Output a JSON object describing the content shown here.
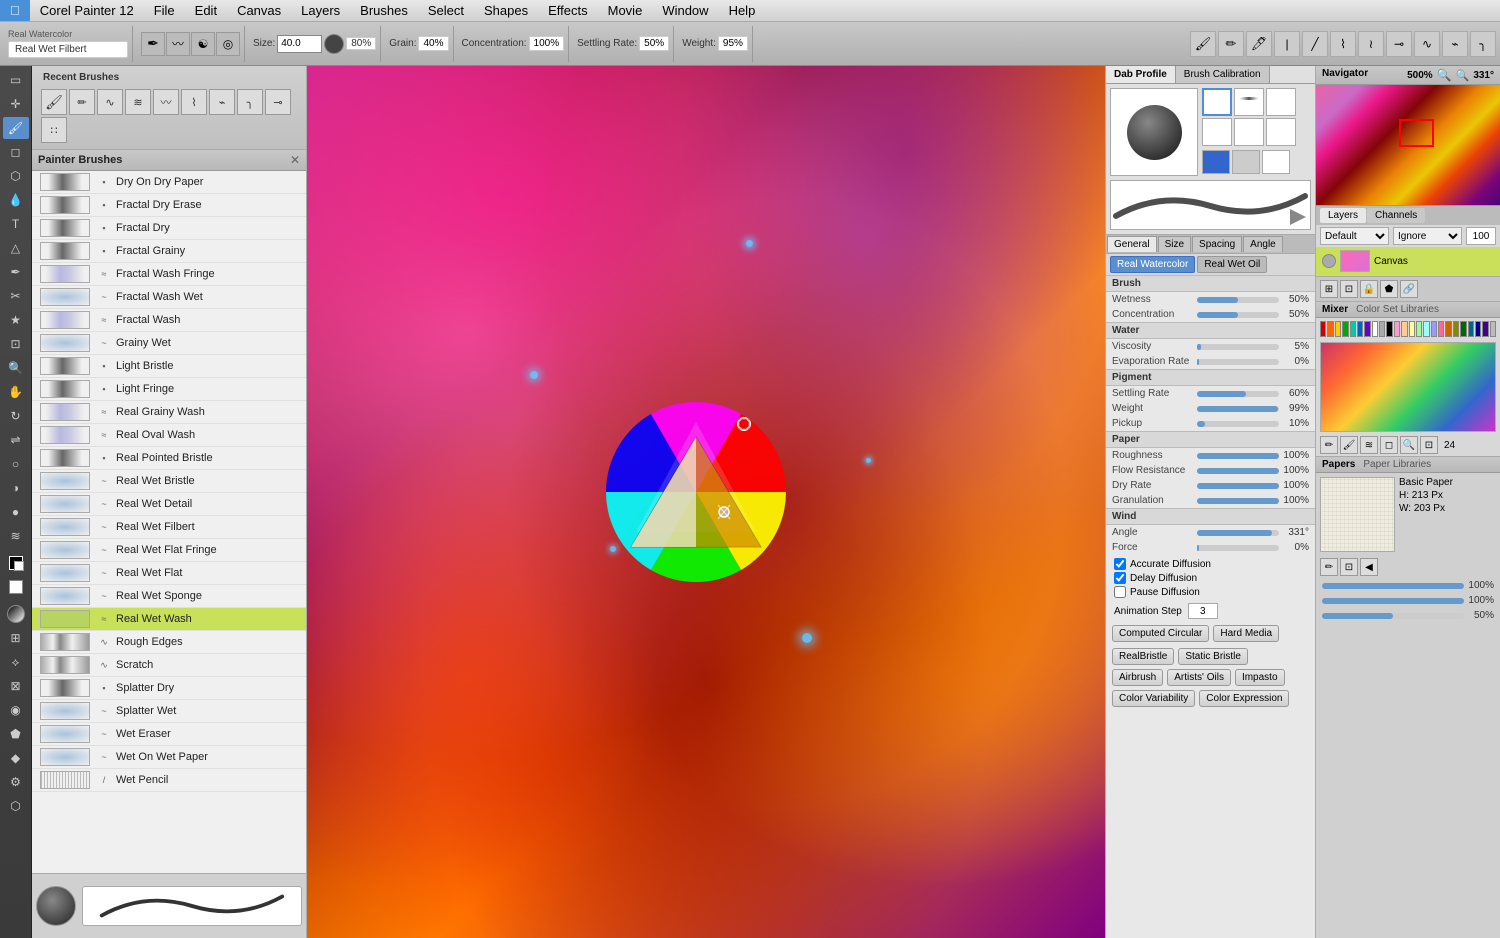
{
  "app": {
    "title": "Corel Painter 12",
    "menus": [
      "File",
      "Edit",
      "Canvas",
      "Layers",
      "Brushes",
      "Select",
      "Shapes",
      "Effects",
      "Movie",
      "Window",
      "Help"
    ]
  },
  "toolbar": {
    "brush_label": "Real Watercolor",
    "brush_name": "Real Wet Filbert",
    "size_value": "40.0",
    "size_unit": "",
    "opacity_label": "80%",
    "grain_label": "Grain:",
    "grain_value": "40%",
    "concentration_label": "Concentration:",
    "concentration_value": "100%",
    "settling_label": "Settling Rate:",
    "settling_value": "50%",
    "weight_label": "Weight:",
    "weight_value": "95%"
  },
  "brush_panel": {
    "recent_label": "Recent Brushes",
    "panel_title": "Painter Brushes",
    "brushes": [
      {
        "name": "Dry On Dry Paper",
        "type": "dry"
      },
      {
        "name": "Fractal Dry Erase",
        "type": "dry"
      },
      {
        "name": "Fractal Dry",
        "type": "dry"
      },
      {
        "name": "Fractal Grainy",
        "type": "dry"
      },
      {
        "name": "Fractal Wash Fringe",
        "type": "wash"
      },
      {
        "name": "Fractal Wash Wet",
        "type": "wet"
      },
      {
        "name": "Fractal Wash",
        "type": "wash"
      },
      {
        "name": "Grainy Wet",
        "type": "wet"
      },
      {
        "name": "Light Bristle",
        "type": "dry"
      },
      {
        "name": "Light Fringe",
        "type": "dry"
      },
      {
        "name": "Real Grainy Wash",
        "type": "wash"
      },
      {
        "name": "Real Oval Wash",
        "type": "wash"
      },
      {
        "name": "Real Pointed Bristle",
        "type": "dry"
      },
      {
        "name": "Real Wet Bristle",
        "type": "wet"
      },
      {
        "name": "Real Wet Detail",
        "type": "wet"
      },
      {
        "name": "Real Wet Filbert",
        "type": "wet"
      },
      {
        "name": "Real Wet Flat Fringe",
        "type": "wet"
      },
      {
        "name": "Real Wet Flat",
        "type": "wet"
      },
      {
        "name": "Real Wet Sponge",
        "type": "wet"
      },
      {
        "name": "Real Wet Wash",
        "type": "wash",
        "selected": true
      },
      {
        "name": "Rough Edges",
        "type": "rough"
      },
      {
        "name": "Scratch",
        "type": "rough"
      },
      {
        "name": "Splatter Dry",
        "type": "dry"
      },
      {
        "name": "Splatter Wet",
        "type": "wet"
      },
      {
        "name": "Wet Eraser",
        "type": "wet"
      },
      {
        "name": "Wet On Wet Paper",
        "type": "wet"
      },
      {
        "name": "Wet Pencil",
        "type": "pencil"
      }
    ]
  },
  "dab_profile": {
    "tab1": "Dab Profile",
    "tab2": "Brush Calibration"
  },
  "properties": {
    "tabs": {
      "general": "General",
      "size": "Size",
      "spacing": "Spacing",
      "angle": "Angle"
    },
    "watercolor_tabs": {
      "tab1": "Real Watercolor",
      "tab2": "Real Wet Oil"
    },
    "brush_section": "Brush",
    "wetness_label": "Wetness",
    "wetness_value": "50%",
    "concentration_label": "Concentration",
    "concentration_value": "50%",
    "water_section": "Water",
    "viscosity_label": "Viscosity",
    "viscosity_value": "5%",
    "evaporation_label": "Evaporation Rate",
    "evaporation_value": "0%",
    "pigment_section": "Pigment",
    "settling_label": "Settling Rate",
    "settling_value": "60%",
    "weight_label": "Weight",
    "weight_value": "99%",
    "pickup_label": "Pickup",
    "pickup_value": "10%",
    "paper_section": "Paper",
    "roughness_label": "Roughness",
    "roughness_value": "100%",
    "flow_label": "Flow Resistance",
    "flow_value": "100%",
    "dry_label": "Dry Rate",
    "dry_value": "100%",
    "granulation_label": "Granulation",
    "granulation_value": "100%",
    "wind_section": "Wind",
    "angle_label": "Angle",
    "angle_value": "331°",
    "force_label": "Force",
    "force_value": "0%",
    "accurate_diffusion": "Accurate Diffusion",
    "delay_diffusion": "Delay Diffusion",
    "pause_diffusion": "Pause Diffusion",
    "animation_step": "Animation Step",
    "animation_value": "3",
    "computed_circular": "Computed Circular",
    "hard_media": "Hard Media",
    "realbristle": "RealBristle",
    "static_bristle": "Static Bristle",
    "airbrush": "Airbrush",
    "artists_oils": "Artists' Oils",
    "impasto": "Impasto",
    "color_variability": "Color Variability",
    "color_expression": "Color Expression"
  },
  "navigator": {
    "title": "Navigator",
    "zoom": "500%",
    "rotation": "331°"
  },
  "layers": {
    "tab1": "Layers",
    "tab2": "Channels",
    "canvas_name": "Canvas",
    "mode_label": "Default",
    "ignore_label": "Ignore",
    "opacity": "100"
  },
  "mixer": {
    "tab1": "Mixer",
    "tab2": "Color Set Libraries",
    "swatches": [
      "#cc0000",
      "#ff6600",
      "#ffcc00",
      "#00aa00",
      "#00ccaa",
      "#0066cc",
      "#6600cc",
      "#ffffff",
      "#aaaaaa",
      "#000000",
      "#ff99cc",
      "#ffcc99",
      "#ffff99",
      "#99ff99",
      "#99ffff",
      "#9999ff",
      "#ff6699",
      "#cc6600",
      "#888800",
      "#006600",
      "#006688",
      "#000088",
      "#440088",
      "#bbbbbb"
    ]
  },
  "papers": {
    "tab1": "Papers",
    "tab2": "Paper Libraries",
    "paper_name": "Basic Paper",
    "height": "213 Px",
    "width": "203 Px",
    "slider1_value": "100%",
    "slider2_value": "100%",
    "slider3_value": "50%"
  }
}
